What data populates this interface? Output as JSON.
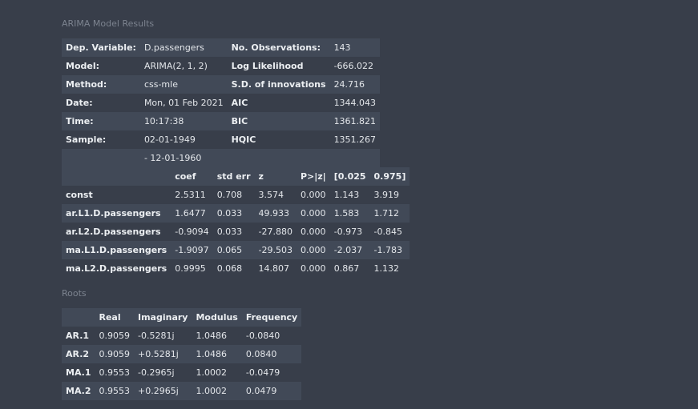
{
  "captions": {
    "model_results": "ARIMA Model Results",
    "roots": "Roots"
  },
  "summary": {
    "rows": [
      [
        "Dep. Variable:",
        "D.passengers",
        "No. Observations:",
        "143"
      ],
      [
        "Model:",
        "ARIMA(2, 1, 2)",
        "Log Likelihood",
        "-666.022"
      ],
      [
        "Method:",
        "css-mle",
        "S.D. of innovations",
        "24.716"
      ],
      [
        "Date:",
        "Mon, 01 Feb 2021",
        "AIC",
        "1344.043"
      ],
      [
        "Time:",
        "10:17:38",
        "BIC",
        "1361.821"
      ],
      [
        "Sample:",
        "02-01-1949",
        "HQIC",
        "1351.267"
      ],
      [
        "",
        "- 12-01-1960",
        "",
        ""
      ]
    ]
  },
  "coefficients": {
    "headers": [
      "",
      "coef",
      "std err",
      "z",
      "P>|z|",
      "[0.025",
      "0.975]"
    ],
    "rows": [
      [
        "const",
        "2.5311",
        "0.708",
        "3.574",
        "0.000",
        "1.143",
        "3.919"
      ],
      [
        "ar.L1.D.passengers",
        "1.6477",
        "0.033",
        "49.933",
        "0.000",
        "1.583",
        "1.712"
      ],
      [
        "ar.L2.D.passengers",
        "-0.9094",
        "0.033",
        "-27.880",
        "0.000",
        "-0.973",
        "-0.845"
      ],
      [
        "ma.L1.D.passengers",
        "-1.9097",
        "0.065",
        "-29.503",
        "0.000",
        "-2.037",
        "-1.783"
      ],
      [
        "ma.L2.D.passengers",
        "0.9995",
        "0.068",
        "14.807",
        "0.000",
        "0.867",
        "1.132"
      ]
    ]
  },
  "roots": {
    "headers": [
      "",
      "Real",
      "Imaginary",
      "Modulus",
      "Frequency"
    ],
    "rows": [
      [
        "AR.1",
        "0.9059",
        "-0.5281j",
        "1.0486",
        "-0.0840"
      ],
      [
        "AR.2",
        "0.9059",
        "+0.5281j",
        "1.0486",
        "0.0840"
      ],
      [
        "MA.1",
        "0.9553",
        "-0.2965j",
        "1.0002",
        "-0.0479"
      ],
      [
        "MA.2",
        "0.9553",
        "+0.2965j",
        "1.0002",
        "0.0479"
      ]
    ]
  },
  "colors": {
    "background": "#383e4a",
    "row_alt": "#414957",
    "caption": "#7c838f",
    "text": "#e3e6ea"
  }
}
